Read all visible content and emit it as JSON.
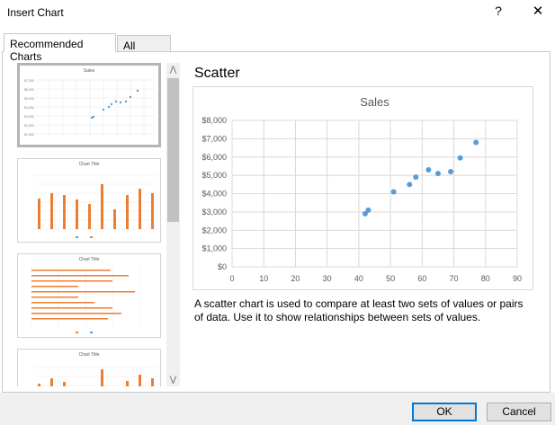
{
  "window": {
    "title": "Insert Chart",
    "help_glyph": "?",
    "close_glyph": "✕"
  },
  "tabs": [
    {
      "label": "Recommended Charts",
      "active": true
    },
    {
      "label": "All Charts",
      "active": false
    }
  ],
  "preview": {
    "name": "Scatter",
    "description": "A scatter chart is used to compare at least two sets of values or pairs of data. Use it to show relationships between sets of values."
  },
  "scrollbar": {
    "up_glyph": "⋀",
    "down_glyph": "⋁"
  },
  "buttons": {
    "ok": "OK",
    "cancel": "Cancel"
  },
  "thumbnails": [
    {
      "title": "Sales",
      "type": "scatter"
    },
    {
      "title": "Chart Title",
      "type": "column",
      "legend": [
        "Axis",
        "Sales"
      ]
    },
    {
      "title": "Chart Title",
      "type": "bar",
      "legend": [
        "Sales",
        "Axis"
      ]
    },
    {
      "title": "Chart Title",
      "type": "column"
    }
  ],
  "colors": {
    "accent": "#ed7d31",
    "series": "#5b9bd5",
    "ok_border": "#0078d7"
  },
  "chart_data": {
    "type": "scatter",
    "title": "Sales",
    "xlim": [
      0,
      90
    ],
    "ylim": [
      0,
      8000
    ],
    "x_ticks": [
      "0",
      "10",
      "20",
      "30",
      "40",
      "50",
      "60",
      "70",
      "80",
      "90"
    ],
    "y_ticks": [
      "$0",
      "$1,000",
      "$2,000",
      "$3,000",
      "$4,000",
      "$5,000",
      "$6,000",
      "$7,000",
      "$8,000"
    ],
    "grid": true,
    "points": [
      {
        "x": 42,
        "y": 2900
      },
      {
        "x": 43,
        "y": 3100
      },
      {
        "x": 51,
        "y": 4100
      },
      {
        "x": 56,
        "y": 4500
      },
      {
        "x": 58,
        "y": 4900
      },
      {
        "x": 62,
        "y": 5300
      },
      {
        "x": 65,
        "y": 5100
      },
      {
        "x": 69,
        "y": 5200
      },
      {
        "x": 72,
        "y": 5950
      },
      {
        "x": 77,
        "y": 6800
      }
    ],
    "color": "#5b9bd5"
  }
}
